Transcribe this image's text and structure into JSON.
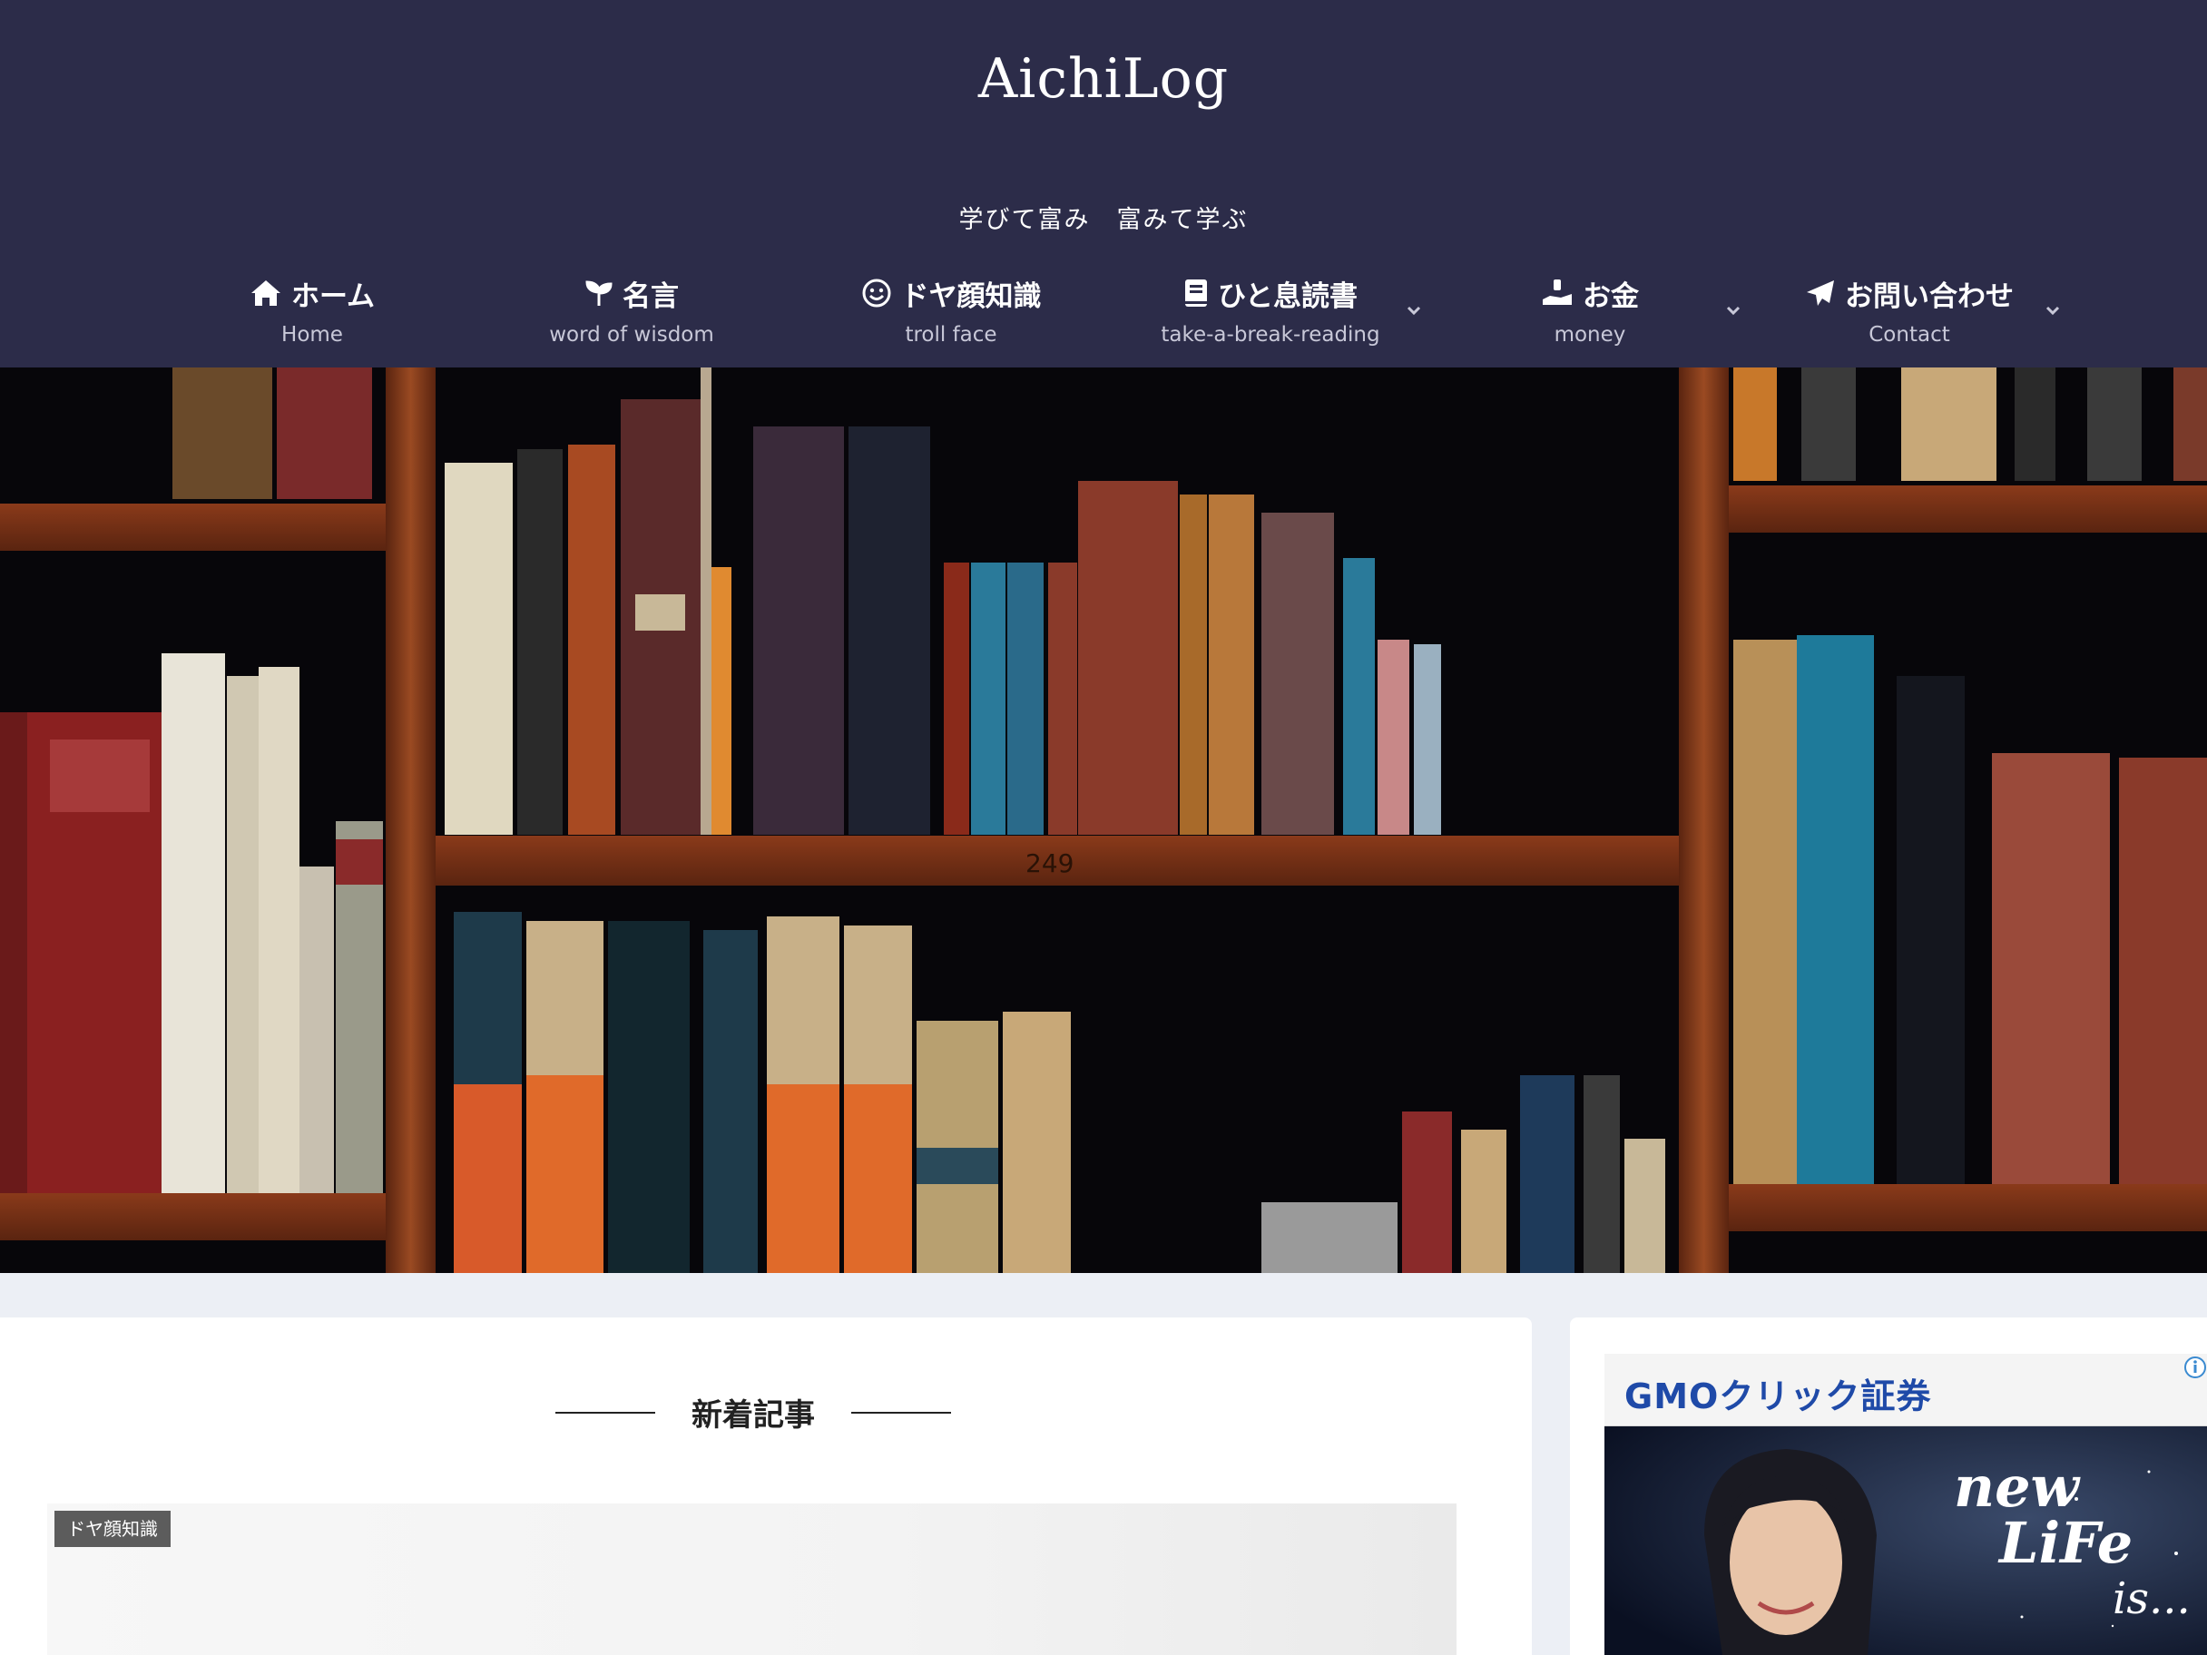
{
  "site": {
    "title": "AichiLog",
    "tagline": "学びて富み　富みて学ぶ"
  },
  "nav": {
    "items": [
      {
        "label": "ホーム",
        "sub": "Home",
        "icon": "home-icon"
      },
      {
        "label": "名言",
        "sub": "word of wisdom",
        "icon": "sprout-icon"
      },
      {
        "label": "ドヤ顔知識",
        "sub": "troll face",
        "icon": "smile-icon"
      },
      {
        "label": "ひと息読書",
        "sub": "take-a-break-reading",
        "icon": "book-icon",
        "has_dropdown": true
      },
      {
        "label": "お金",
        "sub": "money",
        "icon": "hand-holding-money-icon",
        "has_dropdown": true
      },
      {
        "label": "お問い合わせ",
        "sub": "Contact",
        "icon": "paper-plane-icon",
        "has_dropdown": true
      }
    ]
  },
  "hero": {
    "shelf_label": "249"
  },
  "main": {
    "section_title": "新着記事",
    "posts": [
      {
        "category": "ドヤ顔知識"
      }
    ]
  },
  "sidebar": {
    "ad": {
      "brand_blue": "GMO",
      "brand_text": "クリック証券",
      "slogan_line1": "new",
      "slogan_line2": "LiFe",
      "slogan_line3": "is...",
      "colors": {
        "brand_blue": "#1f4aa8",
        "brand_red": "#d9232d"
      }
    }
  },
  "colors": {
    "header_bg": "#2c2c49",
    "page_bg": "#eceff5"
  }
}
